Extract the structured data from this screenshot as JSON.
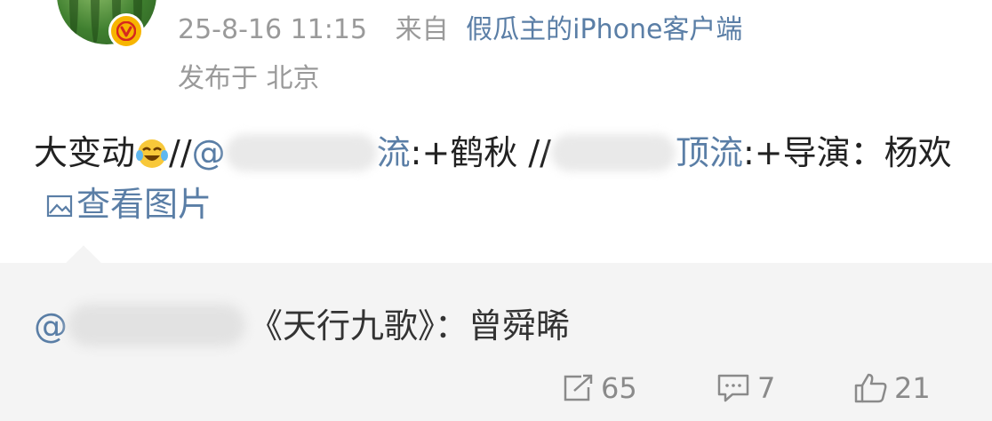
{
  "post": {
    "time": "25-8-16 11:15",
    "source_prefix": "来自",
    "source_client": "假瓜主的iPhone客户端",
    "location": "发布于 北京"
  },
  "content": {
    "text_1": "大变动",
    "text_2": "//",
    "mention_1_start": "@",
    "mention_1_end": "流",
    "text_3": ":+鹤秋 //",
    "mention_2_visible": "顶流",
    "text_4": ":+导演：杨欢",
    "view_images_label": "查看图片"
  },
  "repost": {
    "at": "@",
    "text": "《天行九歌》：曾舜晞"
  },
  "actions": {
    "repost_count": "65",
    "comment_count": "7",
    "like_count": "21"
  },
  "icons": {
    "verified": "verified-v-badge-icon",
    "laugh": "laugh-cry-emoji-icon",
    "image": "image-icon",
    "repost": "repost-icon",
    "comment": "comment-icon",
    "like": "thumbs-up-icon"
  },
  "colors": {
    "link": "#5a7ea6",
    "meta": "#9a9a9a",
    "badge": "#f7b500",
    "repost_bg": "#f4f4f4"
  }
}
